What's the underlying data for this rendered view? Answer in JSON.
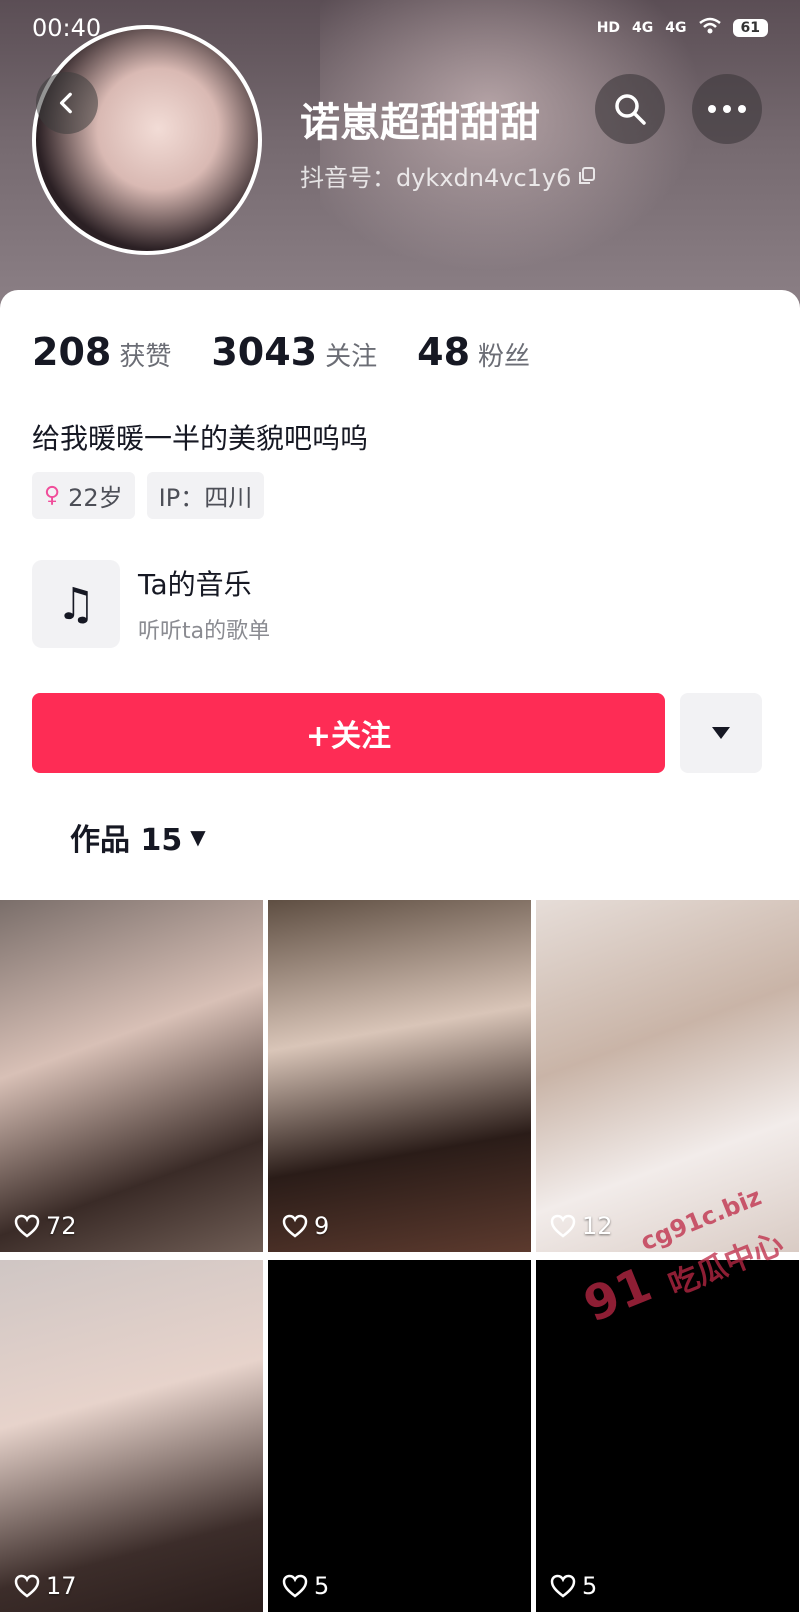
{
  "status_bar": {
    "time": "00:40",
    "signal_hd": "HD",
    "signal_4g_1": "4G",
    "signal_4g_2": "4G",
    "battery": "61"
  },
  "profile": {
    "username": "诺崽超甜甜甜",
    "douyin_id": "抖音号：dykxdn4vc1y6",
    "stats": [
      {
        "num": "208",
        "label": "获赞"
      },
      {
        "num": "3043",
        "label": "关注"
      },
      {
        "num": "48",
        "label": "粉丝"
      }
    ],
    "bio": "给我暖暖一半的美貌吧呜呜",
    "tags": {
      "age": "22岁",
      "ip": "IP：四川"
    }
  },
  "music": {
    "title": "Ta的音乐",
    "subtitle": "听听ta的歌单"
  },
  "actions": {
    "follow_label": "+关注"
  },
  "tabs": {
    "works_label": "作品 15"
  },
  "videos": [
    {
      "likes": "72"
    },
    {
      "likes": "9"
    },
    {
      "likes": "12"
    },
    {
      "likes": "17"
    },
    {
      "likes": "5"
    },
    {
      "likes": "5"
    }
  ],
  "watermark": {
    "number": "91",
    "domain": "cg91c.biz",
    "text": "吃瓜中心"
  },
  "colors": {
    "accent": "#fe2c55",
    "female_tag": "#f04d9a"
  }
}
